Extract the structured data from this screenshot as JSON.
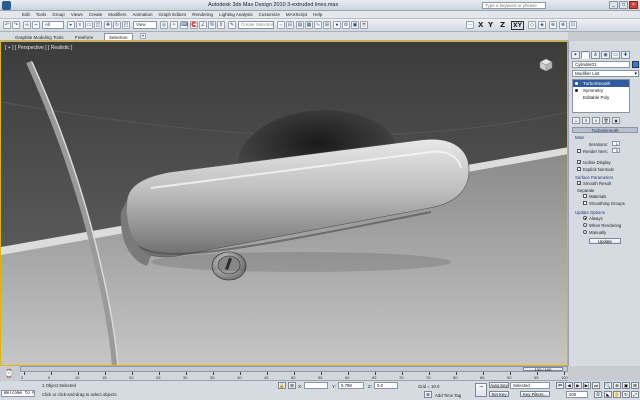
{
  "window": {
    "title": "Autodesk 3ds Max Design 2010     3-extruded lines.max",
    "search_placeholder": "Type a keyword or phrase"
  },
  "menu": [
    "Edit",
    "Tools",
    "Group",
    "Views",
    "Create",
    "Modifiers",
    "Animation",
    "Graph Editors",
    "Rendering",
    "Lighting Analysis",
    "Customize",
    "MAXScript",
    "Help"
  ],
  "toolbar": {
    "filter_value": "All",
    "refcoord_value": "View",
    "named_selection_placeholder": "Create Selection Se",
    "axes": [
      "X",
      "Y",
      "Z",
      "XY"
    ]
  },
  "ribbon": {
    "tabs": [
      "Graphite Modeling Tools",
      "Freeform",
      "Selection"
    ],
    "active_tab": "Selection"
  },
  "viewport": {
    "label": "[ + ] [ Perspective ] [ Realistic ]"
  },
  "command_panel": {
    "object_name": "Cylinder01",
    "object_color": "#2d7ad8",
    "modifier_list_label": "Modifier List",
    "stack": [
      {
        "label": "TurboSmooth",
        "selected": true
      },
      {
        "label": "Symmetry",
        "selected": false
      },
      {
        "label": "Editable Poly",
        "selected": false
      }
    ],
    "rollout_title": "TurboSmooth",
    "main_group": "Main",
    "iterations_label": "Iterations:",
    "iterations_value": "1",
    "render_iters_label": "Render Iters:",
    "render_iters_value": "0",
    "isoline_label": "Isoline Display",
    "explicit_normals_label": "Explicit Normals",
    "surface_params_group": "Surface Parameters",
    "smooth_result_label": "Smooth Result",
    "separate_label": "Separate",
    "materials_label": "Materials",
    "smoothing_groups_label": "Smoothing Groups",
    "update_options_group": "Update Options",
    "always_label": "Always",
    "when_rendering_label": "When Rendering",
    "manually_label": "Manually",
    "update_button": "Update"
  },
  "timeline": {
    "frame_readout": "100 / 100",
    "ticks": [
      "0",
      "5",
      "10",
      "15",
      "20",
      "25",
      "30",
      "35",
      "40",
      "45",
      "50",
      "55",
      "60",
      "65",
      "70",
      "75",
      "80",
      "85",
      "90",
      "95",
      "100"
    ]
  },
  "status": {
    "listener_text": "Welcome to M",
    "selection_text": "1 Object Selected",
    "prompt_text": "Click or click-and-drag to select objects",
    "x_label": "X:",
    "y_label": "Y:",
    "y_value": "0.788",
    "z_label": "Z:",
    "z_value": "0.0",
    "grid_text": "Grid = 10.0",
    "add_time_tag": "Add Time Tag",
    "auto_key": "Auto Key",
    "set_key": "Set Key",
    "selected_option": "Selected",
    "key_filters": "Key Filters...",
    "current_frame": "100"
  }
}
